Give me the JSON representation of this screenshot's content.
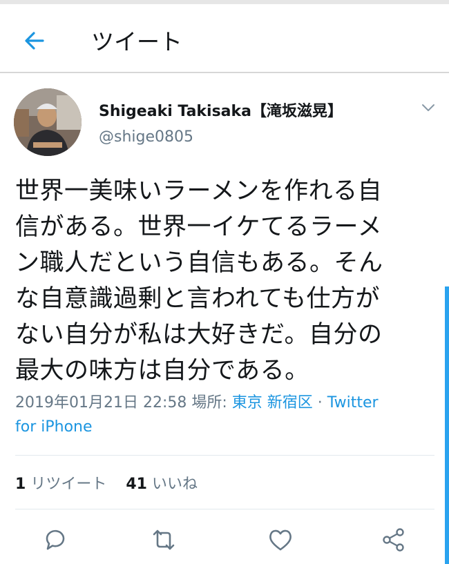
{
  "header": {
    "title": "ツイート",
    "back_icon": "arrow-left-icon"
  },
  "user": {
    "name": "Shigeaki Takisaka【滝坂滋晃】",
    "handle": "@shige0805"
  },
  "tweet": {
    "lines": [
      "世界一美味いラーメンを作れる自",
      "信がある。世界一イケてるラーメ",
      "ン職人だという自信もある。そん",
      "な自意識過剰と言われても仕方が",
      "ない自分が私は大好きだ。自分の",
      "最大の味方は自分である。"
    ]
  },
  "meta": {
    "datetime": "2019年01月21日 22:58",
    "location_label": "場所:",
    "location": "東京 新宿区",
    "separator": "·",
    "client_part1": "Twitter",
    "client_part2": "for iPhone"
  },
  "stats": {
    "retweets_count": "1",
    "retweets_label": "リツイート",
    "likes_count": "41",
    "likes_label": "いいね"
  },
  "colors": {
    "accent": "#1b95e0",
    "text": "#14171a",
    "secondary": "#657786",
    "divider": "#e1e8ed"
  }
}
